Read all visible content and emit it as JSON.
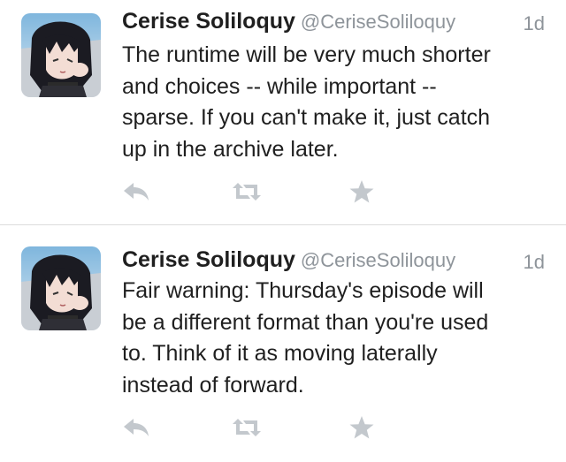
{
  "tweets": [
    {
      "name": "Cerise Soliloquy",
      "handle": "@CeriseSoliloquy",
      "time": "1d",
      "lines": [
        "The runtime will be very much shorter",
        "and choices -- while important --",
        "sparse. If you can't make it, just catch",
        "up in the archive later."
      ]
    },
    {
      "name": "Cerise Soliloquy",
      "handle": "@CeriseSoliloquy",
      "time": "1d",
      "lines": [
        "Fair warning: Thursday's episode will",
        "be a different format than you're used",
        "to. Think of it as moving laterally",
        "instead of forward."
      ]
    }
  ],
  "icons": {
    "reply": "reply-icon",
    "retweet": "retweet-icon",
    "favorite": "favorite-star-icon"
  },
  "colors": {
    "text": "#1f1f1f",
    "meta": "#8e949a",
    "action_icon": "#c3c8cd",
    "divider": "#dcdcdc"
  }
}
